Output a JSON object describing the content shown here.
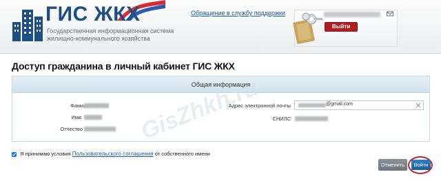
{
  "header": {
    "logo_title": "ГИС ЖКХ",
    "logo_subtitle_line1": "Государственная информационная система",
    "logo_subtitle_line2": "жилищно-коммунального хозяйства",
    "support_link": "Обращение в службу поддержки",
    "logout_label": "Выйти"
  },
  "page": {
    "title": "Доступ гражданина в личный кабинет ГИС ЖКХ"
  },
  "panel": {
    "header": "Общая информация",
    "fields_left": [
      {
        "label": "Фамилия"
      },
      {
        "label": "Имя"
      },
      {
        "label": "Отчество"
      }
    ],
    "email_label": "Адрес электронной почты",
    "email_value": "@gmail.com",
    "snils_label": "СНИЛС"
  },
  "agreement": {
    "prefix": "Я принимаю условия",
    "link": "Пользовательского соглашения",
    "suffix": "от собственного имени",
    "checked": true
  },
  "actions": {
    "cancel_label": "Отменить",
    "login_label": "Войти"
  },
  "watermark": "GisZhkh.ru",
  "colors": {
    "brand_blue": "#1e4f84",
    "logout_red": "#b11d21",
    "login_blue": "#1a5f9f",
    "highlight_red": "#c8202a"
  }
}
